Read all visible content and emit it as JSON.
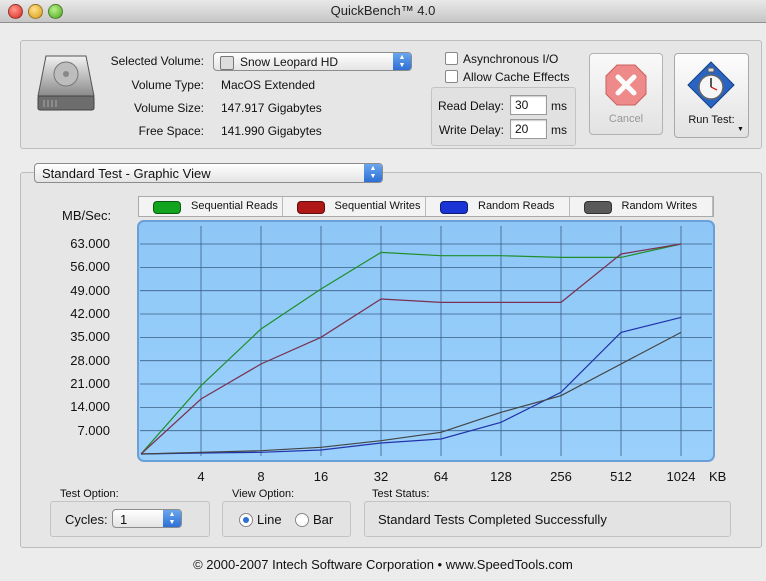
{
  "window": {
    "title": "QuickBench™ 4.0"
  },
  "volume": {
    "selected_label": "Selected Volume:",
    "selected_value": "Snow Leopard HD",
    "type_label": "Volume Type:",
    "type_value": "MacOS Extended",
    "size_label": "Volume Size:",
    "size_value": "147.917 Gigabytes",
    "free_label": "Free Space:",
    "free_value": "141.990 Gigabytes"
  },
  "options": {
    "async_label": "Asynchronous I/O",
    "cache_label": "Allow Cache Effects"
  },
  "delays": {
    "read_label": "Read Delay:",
    "read_value": "30",
    "read_unit": "ms",
    "write_label": "Write Delay:",
    "write_value": "20",
    "write_unit": "ms"
  },
  "buttons": {
    "cancel": "Cancel",
    "run": "Run Test:"
  },
  "view_select": "Standard Test - Graphic View",
  "chart_data": {
    "type": "line",
    "ylabel": "MB/Sec:",
    "xunit": "KB",
    "y_ticks": [
      "63.000",
      "56.000",
      "49.000",
      "42.000",
      "35.000",
      "28.000",
      "21.000",
      "14.000",
      "7.000"
    ],
    "ylim": [
      0,
      70
    ],
    "x": [
      "4",
      "8",
      "16",
      "32",
      "64",
      "128",
      "256",
      "512",
      "1024"
    ],
    "grid": true,
    "legend_position": "top",
    "series": [
      {
        "name": "Sequential Reads",
        "color": "#1f8f2a",
        "swatch": "#13a41f",
        "values": [
          0,
          20.5,
          37.5,
          49.5,
          60.5,
          59.5,
          59.5,
          59,
          59,
          63
        ]
      },
      {
        "name": "Sequential Writes",
        "color": "#7a3050",
        "swatch": "#b01818",
        "values": [
          0,
          16.5,
          27,
          35,
          46.5,
          45.5,
          45.5,
          45.5,
          60,
          63
        ]
      },
      {
        "name": "Random Reads",
        "color": "#2233aa",
        "swatch": "#1a34d6",
        "values": [
          0,
          0.3,
          0.5,
          1.2,
          3.3,
          4.5,
          9.5,
          18.5,
          36.5,
          41
        ]
      },
      {
        "name": "Random Writes",
        "color": "#444444",
        "swatch": "#5a5a5a",
        "values": [
          0,
          0.5,
          1,
          2,
          4,
          6.5,
          12.5,
          17.5,
          27,
          36.5
        ]
      }
    ]
  },
  "test_option": {
    "label": "Test Option:",
    "cycles_label": "Cycles:",
    "cycles_value": "1"
  },
  "view_option": {
    "label": "View Option:",
    "line": "Line",
    "bar": "Bar"
  },
  "test_status": {
    "label": "Test Status:",
    "value": "Standard Tests Completed Successfully"
  },
  "footer": "© 2000-2007 Intech Software Corporation • www.SpeedTools.com"
}
